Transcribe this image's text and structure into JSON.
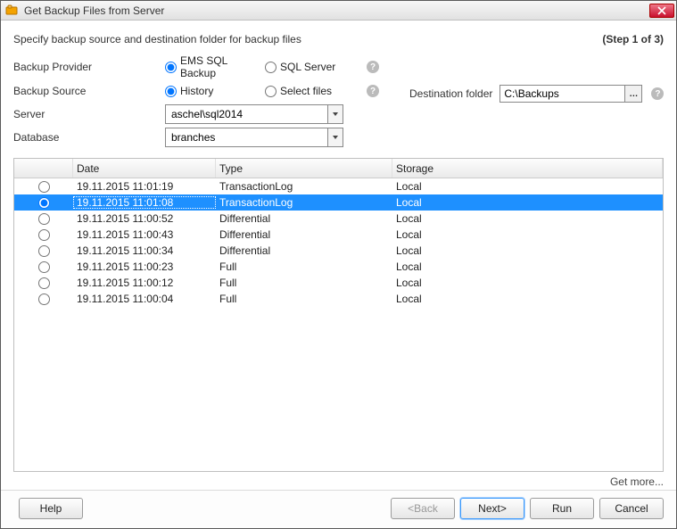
{
  "window": {
    "title": "Get Backup Files from Server"
  },
  "header": {
    "description": "Specify backup source and destination folder for backup files",
    "step": "(Step 1 of 3)"
  },
  "labels": {
    "backup_provider": "Backup Provider",
    "backup_source": "Backup Source",
    "server": "Server",
    "database": "Database",
    "destination_folder": "Destination folder"
  },
  "provider": {
    "options": {
      "ems": "EMS SQL Backup",
      "sqlserver": "SQL Server"
    },
    "selected": "ems"
  },
  "source": {
    "options": {
      "history": "History",
      "select_files": "Select files"
    },
    "selected": "history"
  },
  "server": {
    "value": "aschel\\sql2014"
  },
  "database": {
    "value": "branches"
  },
  "destination": {
    "value": "C:\\Backups"
  },
  "grid": {
    "columns": {
      "date": "Date",
      "type": "Type",
      "storage": "Storage"
    },
    "selected_index": 1,
    "checked_index": 1,
    "rows": [
      {
        "date": "19.11.2015 11:01:19",
        "type": "TransactionLog",
        "storage": "Local"
      },
      {
        "date": "19.11.2015 11:01:08",
        "type": "TransactionLog",
        "storage": "Local"
      },
      {
        "date": "19.11.2015 11:00:52",
        "type": "Differential",
        "storage": "Local"
      },
      {
        "date": "19.11.2015 11:00:43",
        "type": "Differential",
        "storage": "Local"
      },
      {
        "date": "19.11.2015 11:00:34",
        "type": "Differential",
        "storage": "Local"
      },
      {
        "date": "19.11.2015 11:00:23",
        "type": "Full",
        "storage": "Local"
      },
      {
        "date": "19.11.2015 11:00:12",
        "type": "Full",
        "storage": "Local"
      },
      {
        "date": "19.11.2015 11:00:04",
        "type": "Full",
        "storage": "Local"
      }
    ]
  },
  "links": {
    "get_more": "Get more..."
  },
  "buttons": {
    "help": "Help",
    "back": "<Back",
    "next": "Next>",
    "run": "Run",
    "cancel": "Cancel"
  }
}
